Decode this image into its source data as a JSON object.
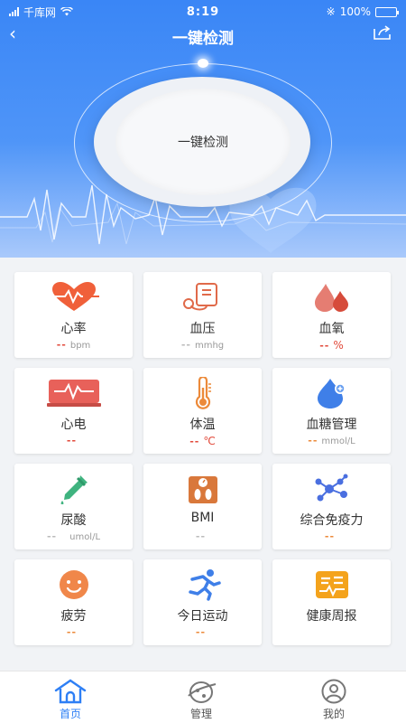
{
  "status": {
    "carrier": "千库网",
    "time": "8:19",
    "battery": "100%"
  },
  "nav": {
    "title": "一键检测"
  },
  "hero": {
    "button_label": "一键检测"
  },
  "metrics": [
    {
      "label": "心率",
      "dash": "--",
      "unit": "bpm",
      "icon": "heart-rate-icon"
    },
    {
      "label": "血压",
      "dash": "--",
      "unit": "mmhg",
      "icon": "blood-pressure-icon"
    },
    {
      "label": "血氧",
      "dash": "--",
      "unit": "%",
      "icon": "blood-oxygen-icon"
    },
    {
      "label": "心电",
      "dash": "--",
      "unit": "",
      "icon": "ecg-icon"
    },
    {
      "label": "体温",
      "dash": "--",
      "unit": "℃",
      "icon": "thermometer-icon"
    },
    {
      "label": "血糖管理",
      "dash": "--",
      "unit": "mmol/L",
      "icon": "blood-sugar-icon"
    },
    {
      "label": "尿酸",
      "dash": "--",
      "unit": "umol/L",
      "icon": "dropper-icon"
    },
    {
      "label": "BMI",
      "dash": "--",
      "unit": "",
      "icon": "scale-icon"
    },
    {
      "label": "综合免疫力",
      "dash": "--",
      "unit": "",
      "icon": "molecule-icon"
    },
    {
      "label": "疲劳",
      "dash": "--",
      "unit": "",
      "icon": "smile-face-icon"
    },
    {
      "label": "今日运动",
      "dash": "--",
      "unit": "",
      "icon": "running-icon"
    },
    {
      "label": "健康周报",
      "dash": "",
      "unit": "",
      "icon": "report-icon"
    }
  ],
  "tabs": [
    {
      "label": "首页",
      "icon": "home-icon",
      "active": true
    },
    {
      "label": "管理",
      "icon": "manage-icon",
      "active": false
    },
    {
      "label": "我的",
      "icon": "profile-icon",
      "active": false
    }
  ],
  "colors": {
    "primary": "#2e7ff5",
    "accent_red": "#e24a3b",
    "accent_orange": "#ec8a3a"
  }
}
